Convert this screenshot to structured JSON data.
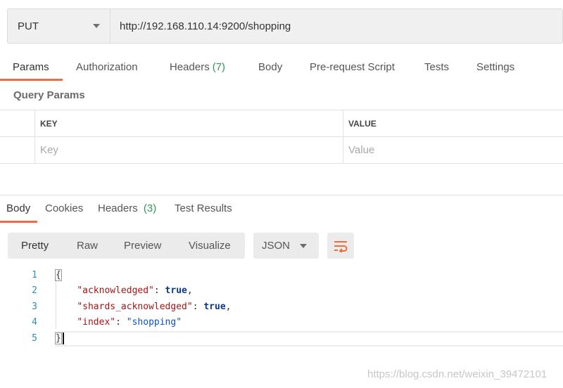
{
  "request": {
    "method": "PUT",
    "url": "http://192.168.110.14:9200/shopping"
  },
  "request_tabs": [
    {
      "label": "Params",
      "count": ""
    },
    {
      "label": "Authorization",
      "count": ""
    },
    {
      "label": "Headers",
      "count": "(7)"
    },
    {
      "label": "Body",
      "count": ""
    },
    {
      "label": "Pre-request Script",
      "count": ""
    },
    {
      "label": "Tests",
      "count": ""
    },
    {
      "label": "Settings",
      "count": ""
    }
  ],
  "query_params": {
    "title": "Query Params",
    "header_key": "KEY",
    "header_value": "VALUE",
    "placeholder_key": "Key",
    "placeholder_value": "Value"
  },
  "response_tabs": [
    {
      "label": "Body",
      "count": ""
    },
    {
      "label": "Cookies",
      "count": ""
    },
    {
      "label": "Headers",
      "count": "(3)"
    },
    {
      "label": "Test Results",
      "count": ""
    }
  ],
  "view_modes": [
    "Pretty",
    "Raw",
    "Preview",
    "Visualize"
  ],
  "format": "JSON",
  "code": {
    "line_numbers": [
      "1",
      "2",
      "3",
      "4",
      "5"
    ],
    "open_brace": "{",
    "close_brace": "}",
    "entries": [
      {
        "key": "\"acknowledged\"",
        "value": "true",
        "suffix": ","
      },
      {
        "key": "\"shards_acknowledged\"",
        "value": "true",
        "suffix": ","
      },
      {
        "key": "\"index\"",
        "value": "\"shopping\"",
        "suffix": ""
      }
    ]
  },
  "watermark": "https://blog.csdn.net/weixin_39472101",
  "colors": {
    "accent": "#f26b3a",
    "count_green": "#2c9a51",
    "json_key": "#a31515",
    "json_bool": "#0d3a8c",
    "json_string": "#0b53b8"
  },
  "icons": {
    "method_dropdown": "chevron-down-icon",
    "format_dropdown": "chevron-down-icon",
    "wrap": "wrap-lines-icon"
  }
}
